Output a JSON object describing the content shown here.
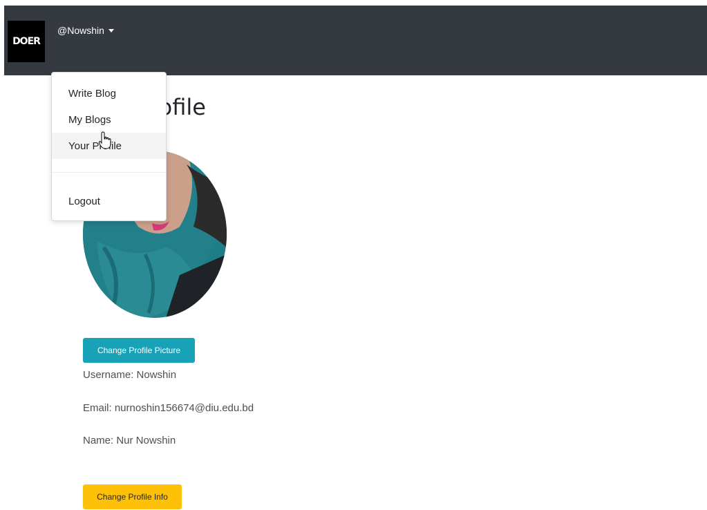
{
  "navbar": {
    "brand": "DOER",
    "username": "@Nowshin",
    "colors": {
      "background": "#343a40",
      "brand_bg": "#000000"
    }
  },
  "dropdown": {
    "items": [
      {
        "label": "Write Blog"
      },
      {
        "label": "My Blogs"
      },
      {
        "label": "Your Profile",
        "hovered": true
      },
      {
        "label": "Logout"
      }
    ]
  },
  "profile": {
    "title": "Your Profile",
    "change_picture_label": "Change Profile Picture",
    "username_line": "Username: Nowshin",
    "email_line": "Email: nurnoshin156674@diu.edu.bd",
    "name_line": "Name: Nur Nowshin",
    "change_info_label": "Change Profile Info"
  },
  "colors": {
    "info_button": "#17a2b8",
    "warning_button": "#ffc107"
  },
  "icons": [
    "caret-down-icon",
    "hand-pointer-icon"
  ]
}
